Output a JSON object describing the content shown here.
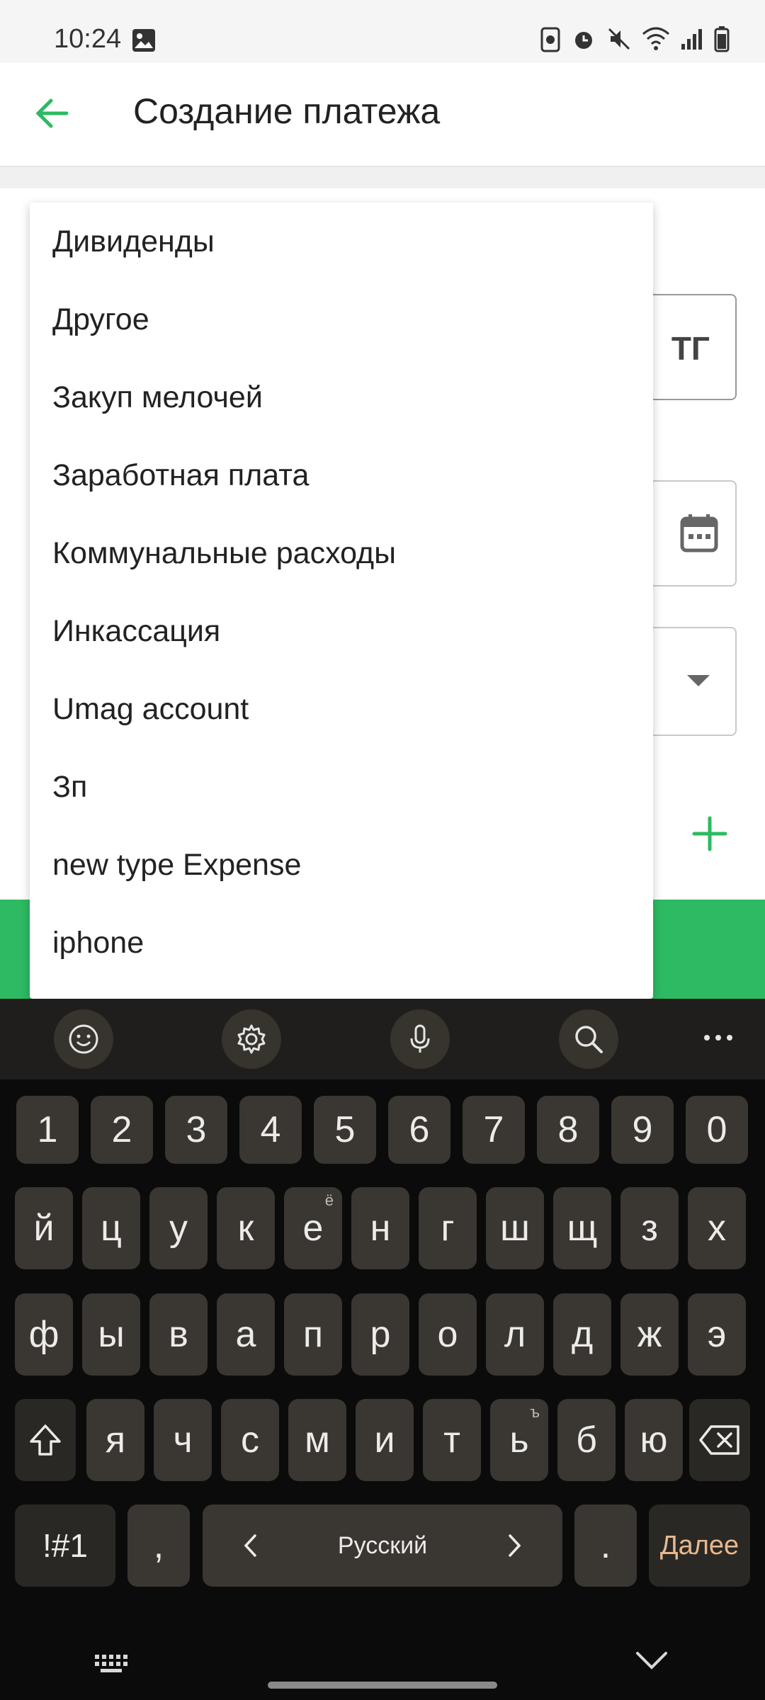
{
  "status": {
    "time": "10:24"
  },
  "header": {
    "title": "Создание платежа"
  },
  "form": {
    "currency": "ТГ"
  },
  "menu": {
    "items": [
      "Дивиденды",
      "Другое",
      "Закуп мелочей",
      "Заработная плата",
      "Коммунальные расходы",
      "Инкассация",
      "Umag account",
      "Зп",
      "new type Expense",
      "iphone"
    ]
  },
  "keyboard": {
    "numbers": [
      "1",
      "2",
      "3",
      "4",
      "5",
      "6",
      "7",
      "8",
      "9",
      "0"
    ],
    "row1": [
      "й",
      "ц",
      "у",
      "к",
      "е",
      "н",
      "г",
      "ш",
      "щ",
      "з",
      "х"
    ],
    "row1_sup": {
      "e": "ё"
    },
    "row2": [
      "ф",
      "ы",
      "в",
      "а",
      "п",
      "р",
      "о",
      "л",
      "д",
      "ж",
      "э"
    ],
    "row3": [
      "я",
      "ч",
      "с",
      "м",
      "и",
      "т",
      "ь",
      "б",
      "ю"
    ],
    "row3_sup": {
      "soft": "ъ"
    },
    "symbols_key": "!#1",
    "comma": ",",
    "space_label": "Русский",
    "period": ".",
    "enter_label": "Далее"
  },
  "colors": {
    "accent": "#2dba62",
    "keyboard_bg": "#0b0b0b",
    "key_bg": "#3a3631",
    "enter_text": "#e8b88f"
  }
}
